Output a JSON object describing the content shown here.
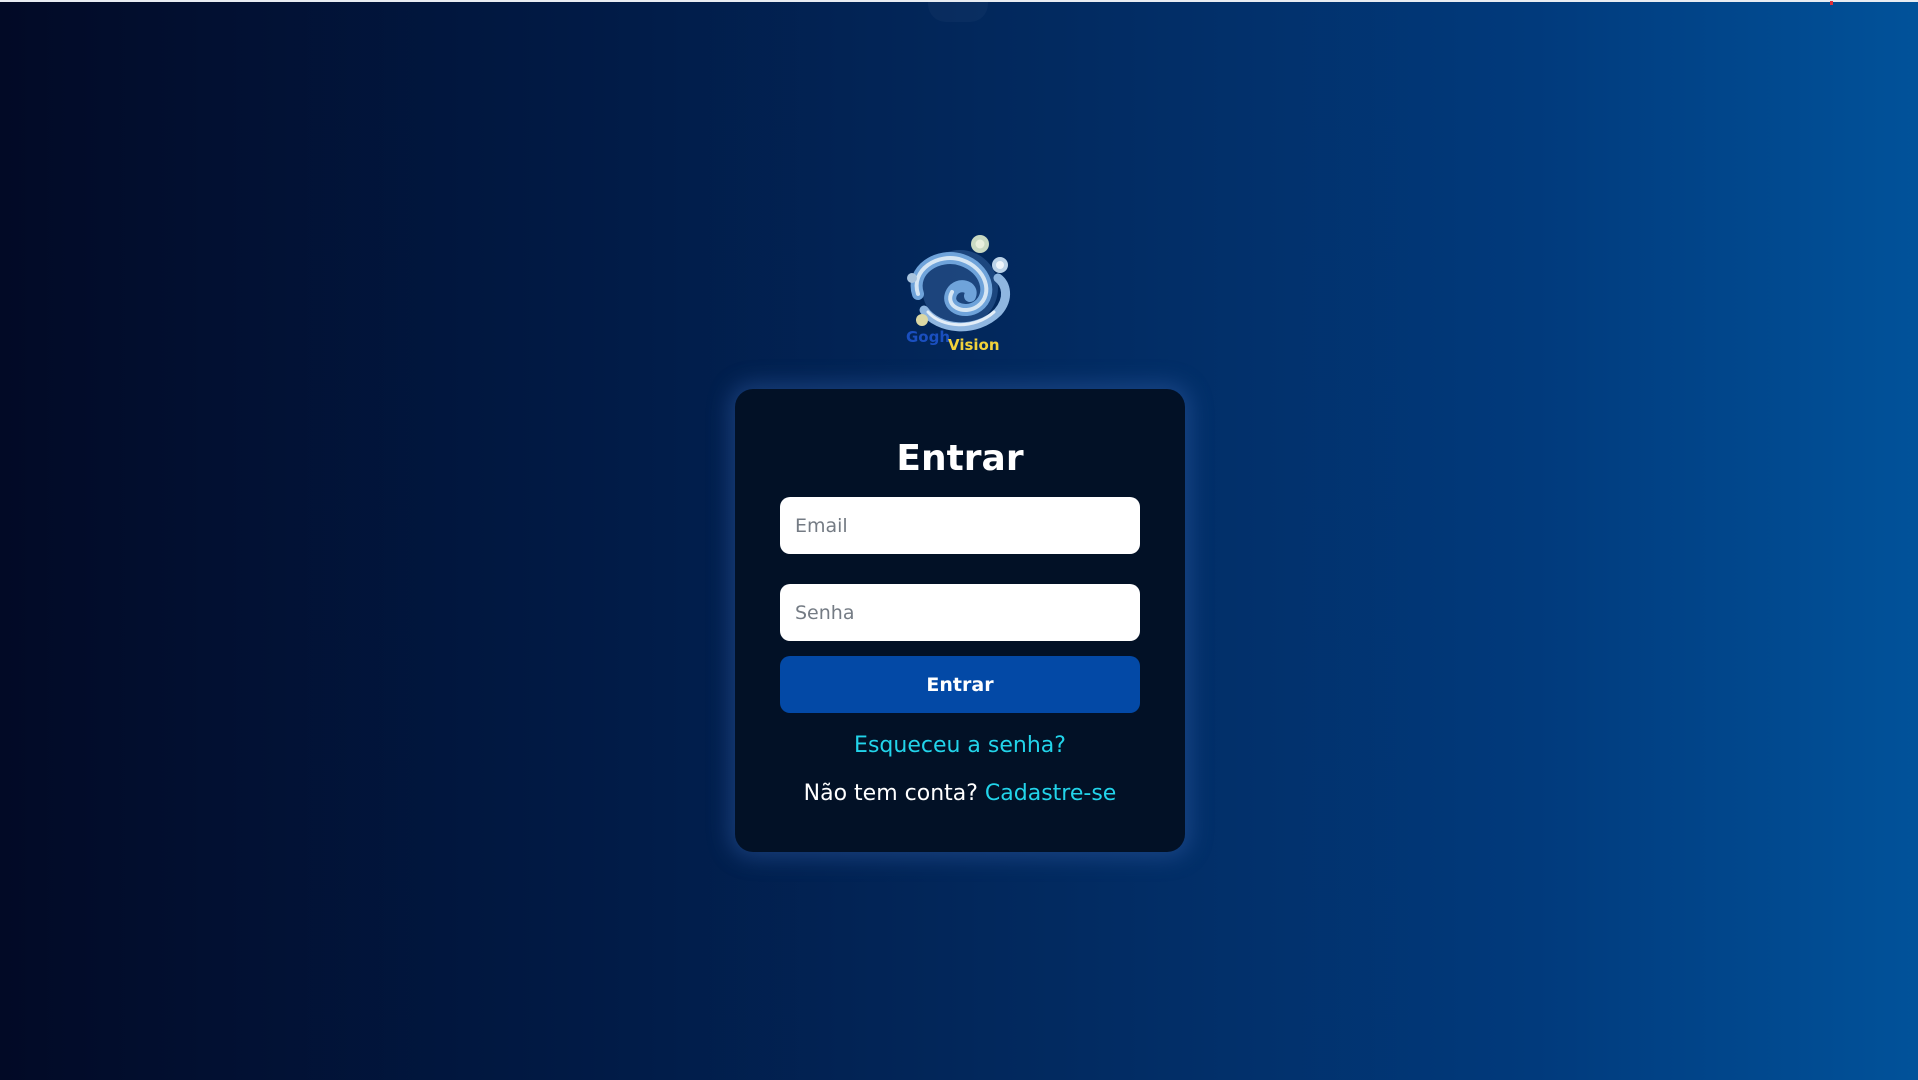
{
  "logo": {
    "icon": "swirl-logo-icon",
    "text_part1": "Gogh",
    "text_part2": "Vision",
    "colors": {
      "swirl": "#6fa3da",
      "swirl_light": "#d6e6f4",
      "text_blue": "#1a4fbf",
      "text_yellow": "#f1d23a"
    }
  },
  "login": {
    "title": "Entrar",
    "email_placeholder": "Email",
    "password_placeholder": "Senha",
    "submit_label": "Entrar",
    "forgot_label": "Esqueceu a senha?",
    "no_account_label": "Não tem conta?",
    "signup_label": "Cadastre-se"
  },
  "theme": {
    "accent": "#0349a6",
    "link": "#22d4ea",
    "card_background": "#021126"
  }
}
